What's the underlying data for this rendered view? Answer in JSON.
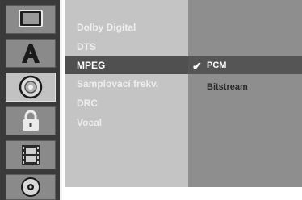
{
  "icons": [
    {
      "name": "tv-icon",
      "active": false
    },
    {
      "name": "language-letter-a-icon",
      "active": false
    },
    {
      "name": "audio-disc-icon",
      "active": true
    },
    {
      "name": "lock-icon",
      "active": false
    },
    {
      "name": "film-strip-icon",
      "active": false
    },
    {
      "name": "disc-icon",
      "active": false
    }
  ],
  "menu": {
    "items": [
      {
        "label": "Dolby Digital"
      },
      {
        "label": "DTS"
      },
      {
        "label": "MPEG",
        "selected": true
      },
      {
        "label": "Samplovací frekv."
      },
      {
        "label": "DRC"
      },
      {
        "label": "Vocal"
      }
    ]
  },
  "options": {
    "items": [
      {
        "label": "PCM",
        "checked": true
      },
      {
        "label": "Bitstream",
        "checked": false
      }
    ],
    "check_glyph": "✔"
  },
  "colors": {
    "icon_column": "#3a3a3a",
    "menu_bg": "#c4c4c4",
    "options_bg": "#8e8e8e",
    "highlight": "#505050"
  }
}
